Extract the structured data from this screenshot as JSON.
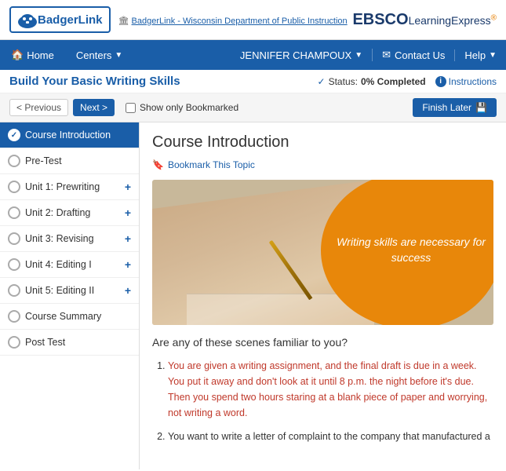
{
  "header": {
    "logo_text": "BadgerLink",
    "dept_link": "BadgerLink - Wisconsin Department of Public Instruction",
    "ebsco_text": "EBSCO",
    "learning_text": "LearningExpress"
  },
  "nav": {
    "home_label": "Home",
    "centers_label": "Centers",
    "user_name": "JENNIFER CHAMPOUX",
    "contact_label": "Contact Us",
    "help_label": "Help"
  },
  "page": {
    "title": "Build Your Basic Writing Skills",
    "status_label": "Status:",
    "status_value": "0% Completed",
    "instructions_label": "Instructions"
  },
  "controls": {
    "prev_label": "< Previous",
    "next_label": "Next >",
    "bookmark_label": "Show only Bookmarked",
    "finish_label": "Finish Later"
  },
  "sidebar": {
    "items": [
      {
        "label": "Course Introduction",
        "active": true,
        "has_plus": false
      },
      {
        "label": "Pre-Test",
        "active": false,
        "has_plus": false
      },
      {
        "label": "Unit 1: Prewriting",
        "active": false,
        "has_plus": true
      },
      {
        "label": "Unit 2: Drafting",
        "active": false,
        "has_plus": true
      },
      {
        "label": "Unit 3: Revising",
        "active": false,
        "has_plus": true
      },
      {
        "label": "Unit 4: Editing I",
        "active": false,
        "has_plus": true
      },
      {
        "label": "Unit 5: Editing II",
        "active": false,
        "has_plus": true
      },
      {
        "label": "Course Summary",
        "active": false,
        "has_plus": false
      },
      {
        "label": "Post Test",
        "active": false,
        "has_plus": false
      }
    ]
  },
  "content": {
    "title": "Course Introduction",
    "bookmark_label": "Bookmark This Topic",
    "hero_text": "Writing skills are necessary for success",
    "passage_intro": "Are any of these scenes familiar to you?",
    "list_items": [
      {
        "text_parts": [
          {
            "text": "You are given a writing assignment, and the final draft is due in a week. ",
            "style": "highlight"
          },
          {
            "text": "You put it away and don't look at it until 8 p.m. the night before it's due. Then you spend two hours staring at a blank piece of paper and worrying, not writing a word.",
            "style": "highlight"
          }
        ]
      },
      {
        "text_parts": [
          {
            "text": "You want to write a letter of complaint to the company that manufactured a",
            "style": "normal"
          }
        ]
      }
    ]
  }
}
